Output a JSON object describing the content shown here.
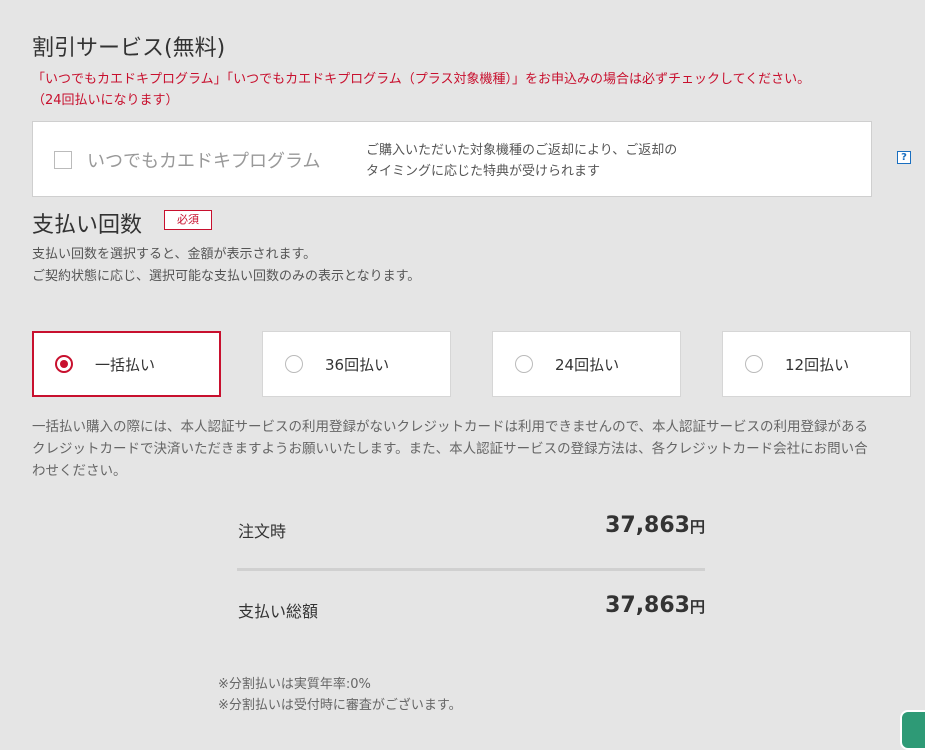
{
  "discount": {
    "title": "割引サービス(無料)",
    "notice_line1": "「いつでもカエドキプログラム」「いつでもカエドキプログラム（プラス対象機種）」をお申込みの場合は必ずチェックしてください。",
    "notice_line2": "（24回払いになります）",
    "checkbox_label": "いつでもカエドキプログラム",
    "desc_line1": "ご購入いただいた対象機種のご返却により、ご返却の",
    "desc_line2": "タイミングに応じた特典が受けられます",
    "help_label": "?"
  },
  "payment": {
    "title": "支払い回数",
    "required_badge": "必須",
    "sub_line1": "支払い回数を選択すると、金額が表示されます。",
    "sub_line2": "ご契約状態に応じ、選択可能な支払い回数のみの表示となります。",
    "options": [
      {
        "label": "一括払い",
        "selected": true
      },
      {
        "label": "36回払い",
        "selected": false
      },
      {
        "label": "24回払い",
        "selected": false
      },
      {
        "label": "12回払い",
        "selected": false
      }
    ],
    "note_line1": "一括払い購入の際には、本人認証サービスの利用登録がないクレジットカードは利用できませんので、本人認証サービスの利用登録がある",
    "note_line2": "クレジットカードで決済いただきますようお願いいたします。また、本人認証サービスの登録方法は、各クレジットカード会社にお問い合",
    "note_line3": "わせください。"
  },
  "summary": {
    "order_label": "注文時",
    "order_value": "37,863",
    "total_label": "支払い総額",
    "total_value": "37,863",
    "currency": "円"
  },
  "footnotes": {
    "line1": "※分割払いは実質年率:0%",
    "line2": "※分割払いは受付時に審査がございます。"
  },
  "colors": {
    "accent": "#c8102e",
    "background": "#e5e5e5"
  }
}
